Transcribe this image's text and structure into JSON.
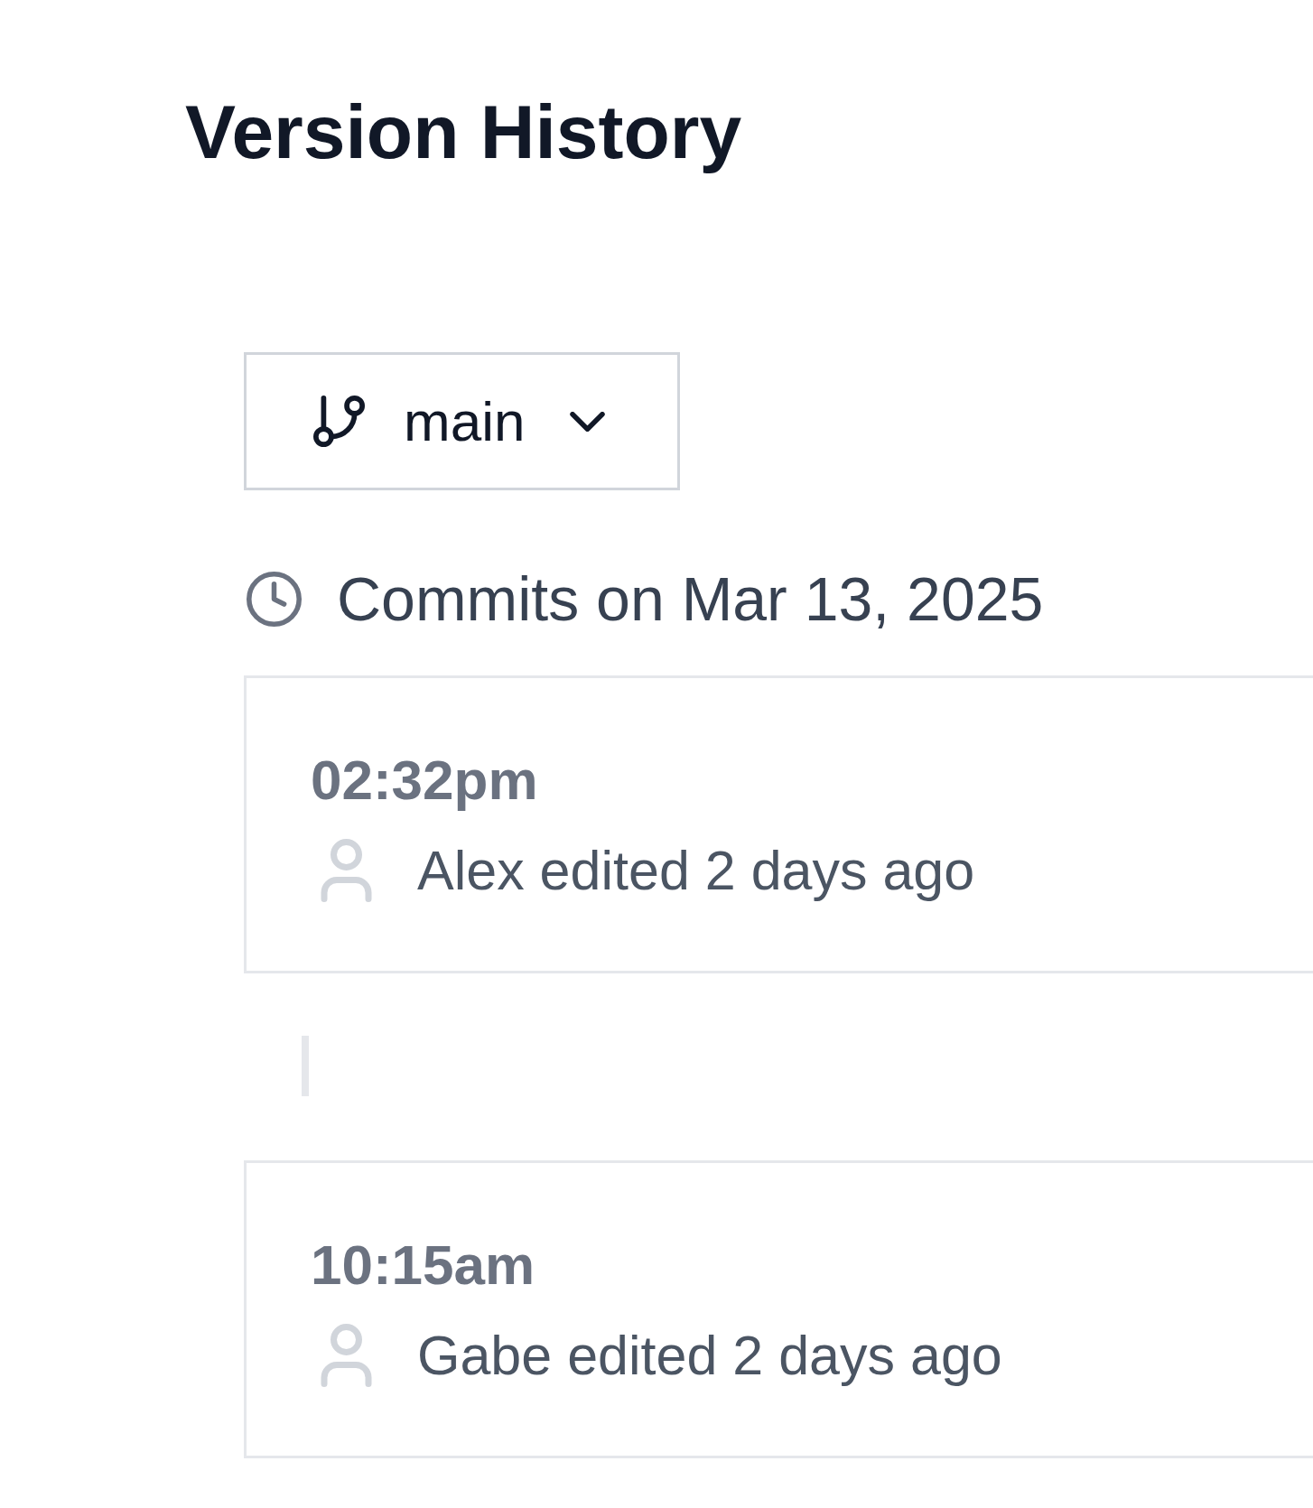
{
  "title": "Version History",
  "branch_selector": {
    "label": "main"
  },
  "commit_group": {
    "heading": "Commits on Mar 13, 2025",
    "commits": [
      {
        "time": "02:32pm",
        "description": "Alex edited 2 days ago"
      },
      {
        "time": "10:15am",
        "description": "Gabe edited 2 days ago"
      }
    ]
  }
}
